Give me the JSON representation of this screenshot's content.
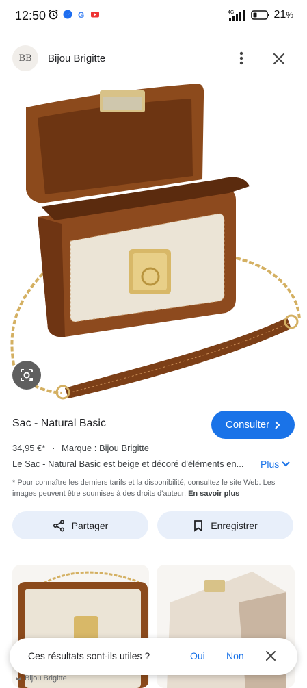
{
  "status_bar": {
    "time": "12:50",
    "network": "4G",
    "battery": "21"
  },
  "header": {
    "logo_text": "BB",
    "brand": "Bijou Brigitte"
  },
  "product": {
    "title": "Sac - Natural Basic",
    "cta": "Consulter",
    "price": "34,95 €*",
    "separator": "·",
    "brand_line": "Marque : Bijou Brigitte",
    "description": "Le Sac - Natural Basic est beige et décoré d'éléments en...",
    "more": "Plus",
    "disclaimer": "* Pour connaître les derniers tarifs et la disponibilité, consultez le site Web. Les images peuvent être soumises à des droits d'auteur.",
    "learn_more": "En savoir plus"
  },
  "actions": {
    "share": "Partager",
    "save": "Enregistrer"
  },
  "feedback": {
    "question": "Ces résultats sont-ils utiles ?",
    "yes": "Oui",
    "no": "Non"
  },
  "bottom_source": "Bijou Brigitte",
  "colors": {
    "accent": "#1a73e8",
    "chip_bg": "#e8effa",
    "leather": "#8a4a20",
    "canvas": "#ece6da",
    "gold": "#d8b868"
  }
}
